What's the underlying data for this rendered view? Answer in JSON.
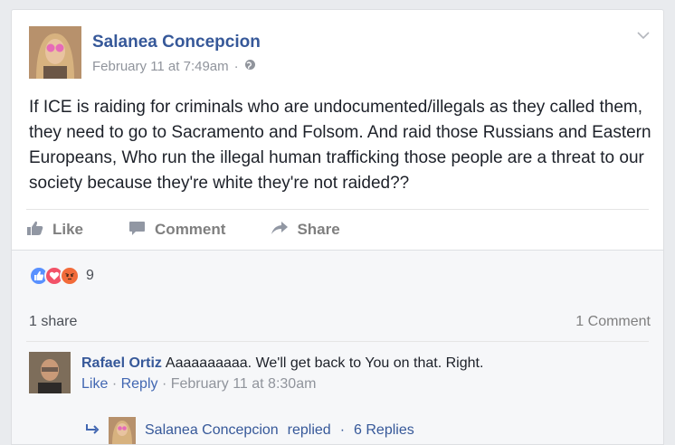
{
  "post": {
    "author": "Salanea Concepcion",
    "timestamp": "February 11 at 7:49am",
    "separator": "·",
    "privacy_icon": "globe-icon",
    "text": "If ICE is raiding for criminals who are undocumented/illegals as they called them, they need to go to Sacramento and Folsom. And raid those Russians and Eastern Europeans, Who run the illegal human trafficking those people are a threat to our society because they're white they're not raided??"
  },
  "actions": {
    "like": "Like",
    "comment": "Comment",
    "share": "Share"
  },
  "footer": {
    "reaction_icons": [
      "like-reaction-icon",
      "love-reaction-icon",
      "angry-reaction-icon"
    ],
    "reaction_count": "9",
    "shares": "1 share",
    "comments": "1 Comment"
  },
  "comment": {
    "author": "Rafael Ortiz",
    "text": "Aaaaaaaaaa. We'll get back to You on that. Right.",
    "like": "Like",
    "dot1": "·",
    "reply": "Reply",
    "dot2": "·",
    "time": "February 11 at 8:30am"
  },
  "reply_summary": {
    "name": "Salanea Concepcion",
    "verb": "replied",
    "dot": "·",
    "count": "6 Replies"
  },
  "colors": {
    "link": "#365899",
    "meta": "#90949c",
    "background": "#e9ebee"
  }
}
